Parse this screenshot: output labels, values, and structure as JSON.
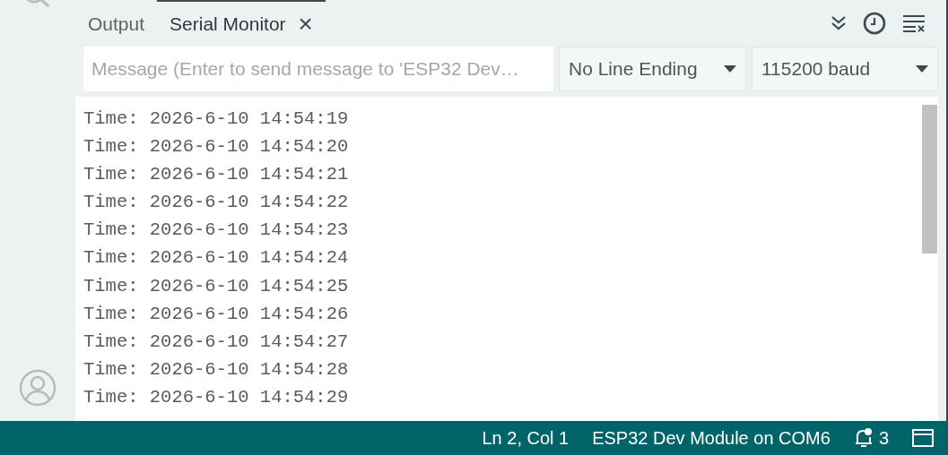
{
  "tabs": [
    {
      "label": "Output",
      "selected": false,
      "closable": false
    },
    {
      "label": "Serial Monitor",
      "selected": true,
      "closable": true,
      "close_glyph": "×"
    }
  ],
  "message": {
    "placeholder": "Message (Enter to send message to 'ESP32 Dev…"
  },
  "line_ending": {
    "value": "No Line Ending"
  },
  "baud": {
    "value": "115200 baud"
  },
  "output_lines": [
    "Time: 2026-6-10 14:54:19",
    "Time: 2026-6-10 14:54:20",
    "Time: 2026-6-10 14:54:21",
    "Time: 2026-6-10 14:54:22",
    "Time: 2026-6-10 14:54:23",
    "Time: 2026-6-10 14:54:24",
    "Time: 2026-6-10 14:54:25",
    "Time: 2026-6-10 14:54:26",
    "Time: 2026-6-10 14:54:27",
    "Time: 2026-6-10 14:54:28",
    "Time: 2026-6-10 14:54:29"
  ],
  "status_bar": {
    "cursor": "Ln 2, Col 1",
    "board": "ESP32 Dev Module on COM6",
    "notifications": "3"
  }
}
